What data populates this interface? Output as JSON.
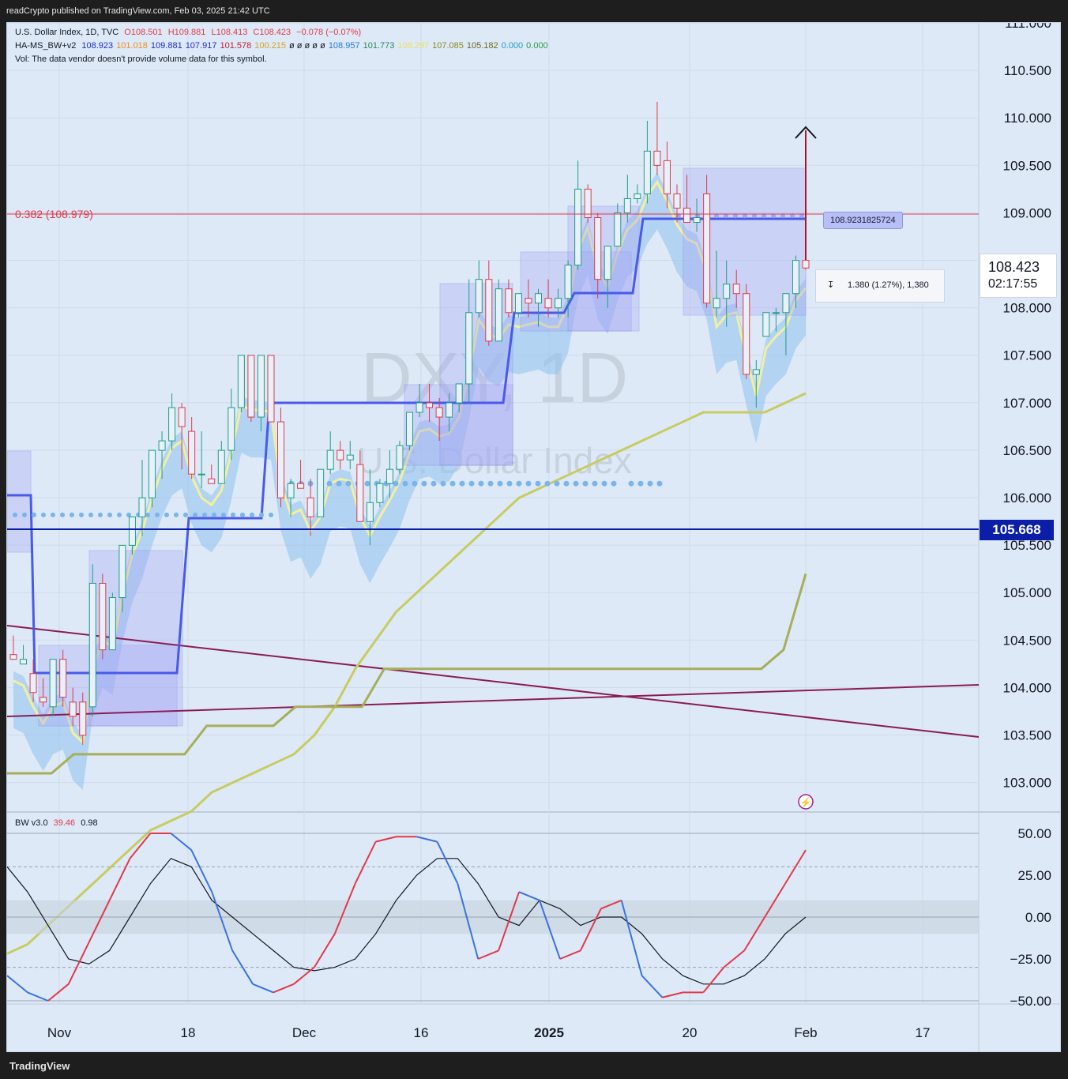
{
  "publisher": "readCrypto published on TradingView.com, Feb 03, 2025 21:42 UTC",
  "brand": "TradingView",
  "legend": {
    "symbol_line": "U.S. Dollar Index, 1D, TVC",
    "ohlc": {
      "o": "O108.501",
      "h": "H109.881",
      "l": "L108.413",
      "c": "C108.423",
      "chg": "−0.078 (−0.07%)"
    },
    "ind_name": "HA-MS_BW+v2",
    "ind_values": [
      {
        "v": "108.923",
        "color": "#1e2bd6"
      },
      {
        "v": "101.018",
        "color": "#f08c1a"
      },
      {
        "v": "109.881",
        "color": "#1e2bd6"
      },
      {
        "v": "107.917",
        "color": "#1e2bd6"
      },
      {
        "v": "101.578",
        "color": "#c02030"
      },
      {
        "v": "100.215",
        "color": "#d4a020"
      },
      {
        "v": "ø ø ø ø ø",
        "color": "#131722"
      },
      {
        "v": "108.957",
        "color": "#2a7ad4"
      },
      {
        "v": "101.773",
        "color": "#2a8a5a"
      },
      {
        "v": "108.297",
        "color": "#e6e060"
      },
      {
        "v": "107.085",
        "color": "#8a8a20"
      },
      {
        "v": "105.182",
        "color": "#6a6a20"
      },
      {
        "v": "0.000",
        "color": "#1aa0c0"
      },
      {
        "v": "0.000",
        "color": "#2a9a4a"
      }
    ],
    "vol_note": "Vol: The data vendor doesn't provide volume data for this symbol."
  },
  "watermark": {
    "ticker": "DXY, 1D",
    "name": "U.S. Dollar Index"
  },
  "fib_label": "0.382 (108.979)",
  "marker_label": "108.9231825724",
  "measure_label": "1.380 (1.27%), 1,380",
  "last_price": "108.423",
  "countdown": "02:17:55",
  "hline_price": "105.668",
  "osc_legend": {
    "name": "BW v3.0",
    "v1": "39.46",
    "v2": "0.98"
  },
  "price_axis": [
    "111.000",
    "110.500",
    "110.000",
    "109.500",
    "109.000",
    "108.500",
    "108.000",
    "107.500",
    "107.000",
    "106.500",
    "106.000",
    "105.500",
    "105.000",
    "104.500",
    "104.000",
    "103.500",
    "103.000"
  ],
  "osc_axis": [
    "50.00",
    "25.00",
    "0.00",
    "−25.00",
    "−50.00"
  ],
  "time_axis": [
    "Nov",
    "18",
    "Dec",
    "16",
    "2025",
    "20",
    "Feb",
    "17"
  ],
  "colors": {
    "bg": "#dde9f7",
    "up": "#1e9e86",
    "down": "#e0394a",
    "fib": "#e0394a",
    "hline": "#0a1ea8"
  },
  "chart_data": {
    "type": "line",
    "title": "U.S. Dollar Index, 1D, TVC",
    "xlabel": "",
    "ylabel": "",
    "ylim": [
      102.7,
      111.0
    ],
    "candles": [
      [
        104.35,
        104.55,
        104.3,
        104.3
      ],
      [
        104.25,
        104.45,
        104.25,
        104.3
      ],
      [
        104.15,
        104.3,
        103.85,
        103.95
      ],
      [
        103.9,
        104.1,
        103.8,
        103.85
      ],
      [
        103.8,
        104.1,
        103.7,
        104.3
      ],
      [
        104.3,
        104.4,
        103.8,
        103.9
      ],
      [
        103.85,
        104.0,
        103.6,
        103.7
      ],
      [
        103.85,
        103.95,
        103.4,
        103.5
      ],
      [
        103.8,
        105.3,
        103.7,
        105.1
      ],
      [
        105.1,
        105.2,
        104.3,
        104.4
      ],
      [
        104.4,
        105.0,
        104.4,
        104.95
      ],
      [
        104.95,
        105.5,
        104.8,
        105.5
      ],
      [
        105.5,
        105.8,
        105.4,
        105.8
      ],
      [
        105.8,
        106.4,
        105.6,
        106.0
      ],
      [
        106.0,
        106.5,
        105.9,
        106.5
      ],
      [
        106.5,
        106.7,
        106.2,
        106.6
      ],
      [
        106.6,
        107.1,
        106.5,
        106.95
      ],
      [
        106.95,
        107.0,
        106.3,
        106.75
      ],
      [
        106.7,
        106.85,
        106.2,
        106.25
      ],
      [
        106.25,
        106.7,
        106.1,
        106.25
      ],
      [
        106.2,
        106.35,
        106.15,
        106.15
      ],
      [
        106.15,
        106.6,
        106.15,
        106.5
      ],
      [
        106.5,
        107.15,
        106.4,
        106.95
      ],
      [
        106.95,
        107.5,
        106.9,
        107.5
      ],
      [
        107.5,
        107.5,
        106.8,
        106.85
      ],
      [
        106.85,
        107.5,
        106.7,
        107.5
      ],
      [
        107.5,
        107.5,
        106.8,
        106.8
      ],
      [
        106.8,
        106.95,
        105.9,
        106.0
      ],
      [
        106.0,
        106.2,
        105.8,
        106.15
      ],
      [
        106.15,
        106.4,
        106.1,
        106.1
      ],
      [
        106.0,
        106.2,
        105.6,
        105.8
      ],
      [
        105.8,
        106.3,
        105.8,
        106.3
      ],
      [
        106.3,
        106.7,
        106.25,
        106.5
      ],
      [
        106.5,
        106.6,
        106.3,
        106.4
      ],
      [
        106.4,
        106.6,
        106.3,
        106.45
      ],
      [
        106.35,
        106.5,
        105.8,
        105.75
      ],
      [
        105.75,
        106.3,
        105.5,
        105.95
      ],
      [
        105.95,
        106.2,
        105.9,
        106.15
      ],
      [
        106.15,
        106.5,
        106.0,
        106.3
      ],
      [
        106.3,
        106.6,
        106.25,
        106.55
      ],
      [
        106.55,
        106.9,
        106.5,
        106.9
      ],
      [
        106.9,
        107.2,
        106.85,
        107.0
      ],
      [
        107.0,
        107.2,
        106.8,
        106.95
      ],
      [
        106.95,
        107.05,
        106.6,
        106.85
      ],
      [
        106.85,
        107.1,
        106.7,
        107.0
      ],
      [
        107.0,
        107.2,
        106.9,
        107.2
      ],
      [
        107.2,
        108.3,
        107.0,
        107.95
      ],
      [
        107.95,
        108.5,
        107.9,
        108.3
      ],
      [
        108.3,
        108.5,
        107.6,
        107.65
      ],
      [
        107.65,
        108.3,
        107.7,
        108.2
      ],
      [
        108.2,
        108.3,
        107.9,
        107.95
      ],
      [
        107.95,
        108.1,
        107.9,
        108.15
      ],
      [
        108.1,
        108.3,
        107.9,
        108.05
      ],
      [
        108.05,
        108.2,
        107.8,
        108.15
      ],
      [
        108.1,
        108.3,
        107.9,
        108.0
      ],
      [
        108.0,
        108.2,
        107.9,
        108.1
      ],
      [
        108.1,
        108.5,
        107.9,
        108.45
      ],
      [
        108.45,
        109.55,
        108.4,
        109.25
      ],
      [
        109.25,
        109.3,
        108.9,
        108.95
      ],
      [
        108.95,
        109.0,
        108.1,
        108.3
      ],
      [
        108.3,
        108.65,
        108.0,
        108.65
      ],
      [
        108.65,
        109.1,
        108.7,
        109.0
      ],
      [
        109.0,
        109.4,
        108.9,
        109.15
      ],
      [
        109.15,
        109.3,
        109.1,
        109.2
      ],
      [
        109.2,
        109.97,
        109.1,
        109.65
      ],
      [
        109.65,
        110.17,
        109.4,
        109.5
      ],
      [
        109.55,
        109.75,
        109.05,
        109.2
      ],
      [
        109.2,
        109.3,
        108.9,
        109.05
      ],
      [
        109.05,
        109.4,
        108.9,
        108.9
      ],
      [
        108.9,
        109.15,
        108.8,
        108.95
      ],
      [
        109.2,
        109.4,
        108.0,
        108.05
      ],
      [
        108.0,
        108.6,
        107.9,
        108.1
      ],
      [
        108.1,
        108.5,
        107.8,
        108.25
      ],
      [
        108.25,
        108.4,
        108.0,
        108.15
      ],
      [
        108.15,
        108.25,
        107.25,
        107.3
      ],
      [
        107.3,
        107.45,
        106.95,
        107.35
      ],
      [
        107.7,
        107.9,
        107.7,
        107.95
      ],
      [
        107.95,
        108.0,
        107.75,
        107.95
      ],
      [
        107.95,
        108.1,
        107.5,
        108.15
      ],
      [
        108.15,
        108.55,
        108.0,
        108.5
      ],
      [
        108.5,
        108.55,
        108.4,
        108.42
      ]
    ],
    "series": [
      {
        "values": [
          101.2,
          101.3,
          101.5,
          101.7,
          101.9,
          102.1,
          102.3,
          102.5,
          102.6,
          102.7,
          102.9,
          103.0,
          103.1,
          103.2,
          103.3,
          103.5,
          103.8,
          104.2,
          104.5,
          104.8,
          105.0,
          105.2,
          105.4,
          105.6,
          105.8,
          106.0,
          106.1,
          106.2,
          106.3,
          106.4,
          106.5,
          106.6,
          106.7,
          106.8,
          106.9,
          106.9,
          106.9,
          106.9,
          107.0,
          107.1
        ]
      },
      {
        "values": [
          103.1,
          103.1,
          103.1,
          103.3,
          103.3,
          103.3,
          103.3,
          103.3,
          103.3,
          103.6,
          103.6,
          103.6,
          103.6,
          103.8,
          103.8,
          103.8,
          103.8,
          104.2,
          104.2,
          104.2,
          104.2,
          104.2,
          104.2,
          104.2,
          104.2,
          104.2,
          104.2,
          104.2,
          104.2,
          104.2,
          104.2,
          104.2,
          104.2,
          104.2,
          104.2,
          104.4,
          105.2
        ]
      }
    ],
    "oscillator": {
      "ylim": [
        -50,
        50
      ],
      "fast": [
        -35,
        -45,
        -50,
        -40,
        -15,
        10,
        35,
        50,
        50,
        40,
        15,
        -20,
        -40,
        -45,
        -40,
        -30,
        -10,
        20,
        45,
        48,
        48,
        45,
        20,
        -25,
        -20,
        15,
        10,
        -25,
        -20,
        5,
        10,
        -35,
        -48,
        -45,
        -45,
        -30,
        -20,
        0,
        20,
        40
      ],
      "slow": [
        30,
        15,
        -5,
        -25,
        -28,
        -20,
        0,
        20,
        35,
        30,
        10,
        0,
        -10,
        -20,
        -30,
        -32,
        -30,
        -25,
        -10,
        10,
        25,
        35,
        35,
        20,
        0,
        -5,
        10,
        5,
        -5,
        0,
        0,
        -10,
        -25,
        -35,
        -40,
        -40,
        -35,
        -25,
        -10,
        0
      ]
    }
  }
}
